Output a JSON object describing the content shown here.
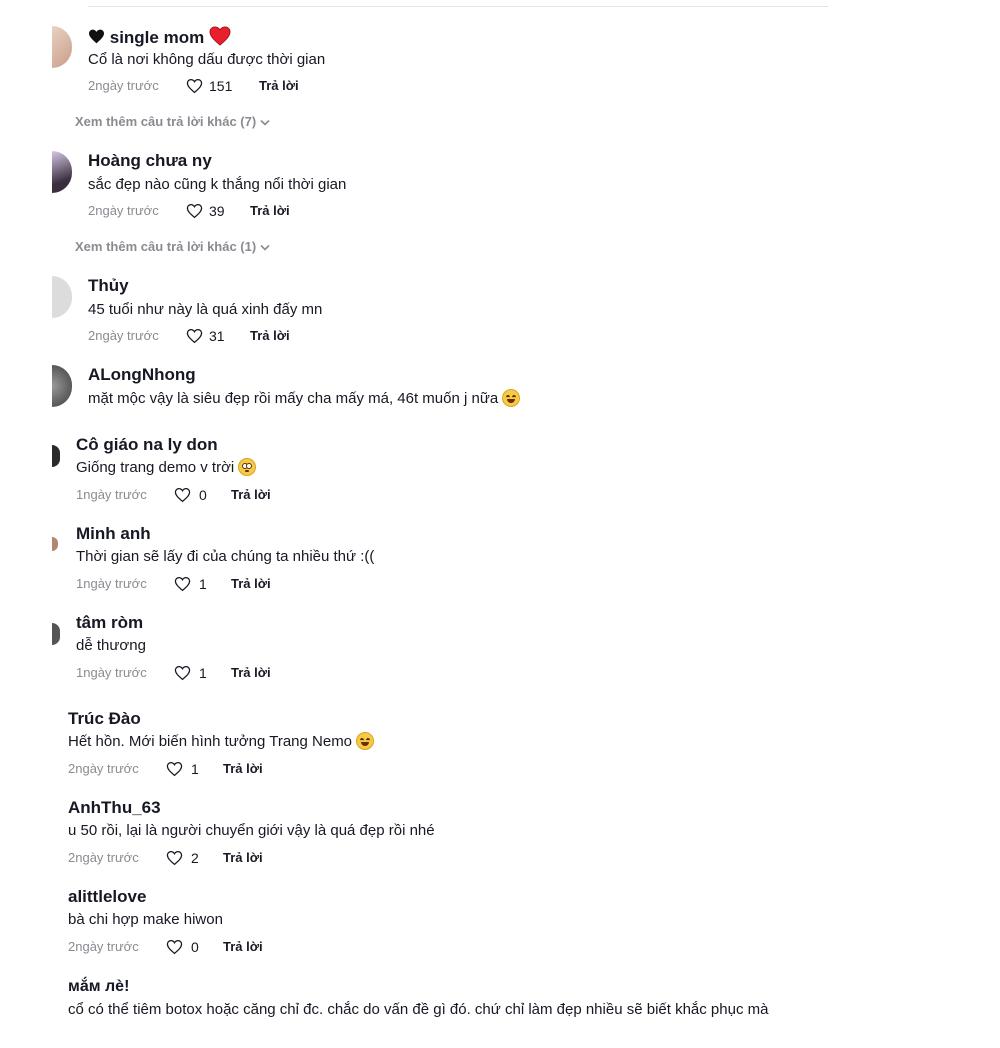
{
  "comments": [
    {
      "username": "single mom",
      "name_prefix_icon": "black-heart-icon",
      "name_suffix_icon": "red-heart-icon",
      "text": "Cổ là nơi không dấu được thời gian",
      "time": "2ngày trước",
      "likes": "151",
      "reply_label": "Trả lời",
      "more_replies": "Xem thêm câu trả lời khác (7)"
    },
    {
      "username": "Hoàng chưa ny",
      "text": "sắc đẹp nào cũng k thắng nổi thời gian",
      "time": "2ngày trước",
      "likes": "39",
      "reply_label": "Trả lời",
      "more_replies": "Xem thêm câu trả lời khác (1)"
    },
    {
      "username": "Thủy",
      "text": "45 tuổi như này là quá xinh đấy mn",
      "time": "2ngày trước",
      "likes": "31",
      "reply_label": "Trả lời"
    },
    {
      "username": "ALongNhong",
      "text": "mặt mộc vậy là siêu đẹp rồi mấy cha mấy má, 46t muốn j nữa",
      "emoji": "laughing-emoji"
    },
    {
      "username": "Cô giáo na ly don",
      "text": "Giống trang demo v trời",
      "emoji": "flushed-emoji",
      "time": "1ngày trước",
      "likes": "0",
      "reply_label": "Trả lời"
    },
    {
      "username": "Minh anh",
      "text": "Thời gian sẽ lấy đi của chúng ta nhiều thứ :((",
      "time": "1ngày trước",
      "likes": "1",
      "reply_label": "Trả lời"
    },
    {
      "username": "tâm ròm",
      "text": "dễ thương",
      "time": "1ngày trước",
      "likes": "1",
      "reply_label": "Trả lời"
    },
    {
      "username": "Trúc Đào",
      "text": "Hết hồn. Mới biến hình tưởng Trang Nemo",
      "emoji": "laughing-emoji",
      "time": "2ngày trước",
      "likes": "1",
      "reply_label": "Trả lời"
    },
    {
      "username": "AnhThu_63",
      "text": "u 50 rồi, lại là người chuyển giới vậy là quá đẹp rồi nhé",
      "time": "2ngày trước",
      "likes": "2",
      "reply_label": "Trả lời"
    },
    {
      "username": "alittlelove",
      "text": "bà chi hợp make hiwon",
      "time": "2ngày trước",
      "likes": "0",
      "reply_label": "Trả lời"
    },
    {
      "username": "мắм лè!",
      "text": "cổ có thể tiêm botox hoặc căng chỉ đc. chắc do vấn đề gì đó. chứ chỉ làm đẹp nhiều sẽ biết khắc phục mà"
    }
  ],
  "colors": {
    "text": "#161823",
    "muted": "#8a8b91",
    "heart_red": "#e8202e"
  }
}
